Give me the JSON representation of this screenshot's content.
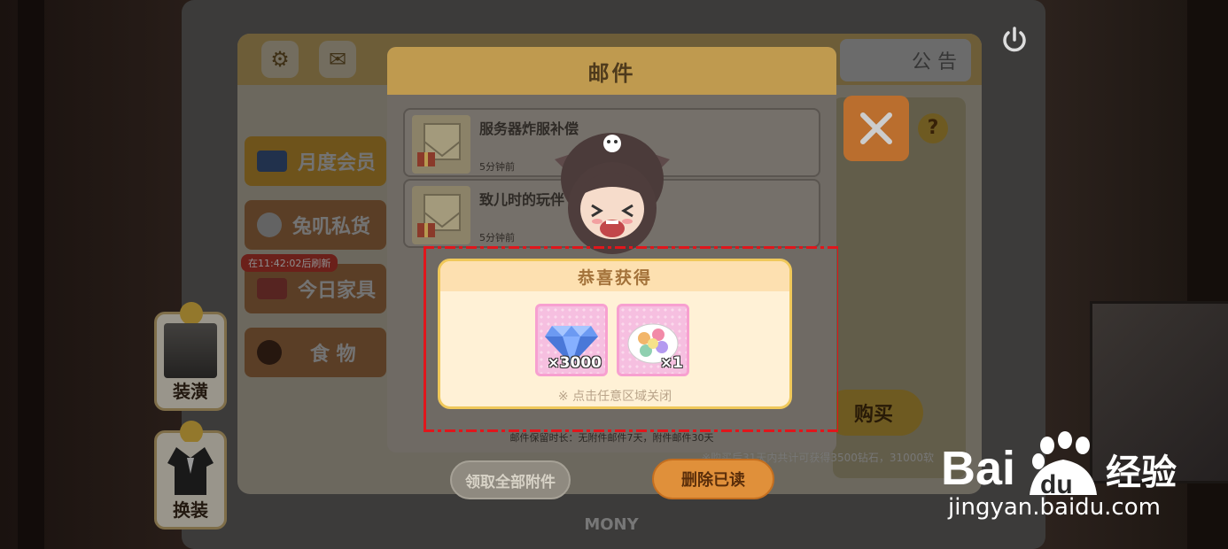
{
  "tv": {
    "brand_label": "MONY"
  },
  "shop": {
    "announce_tab": "公 告",
    "categories": [
      {
        "label": "月度会员"
      },
      {
        "label": "兔叽私货"
      },
      {
        "label": "今日家具",
        "timer": "在11:42:02后刷新"
      },
      {
        "label": "食 物"
      }
    ],
    "buy_label": "购买",
    "footer_note": "※购买后31天内共计可获得3500钻石，31000软"
  },
  "side_buttons": [
    {
      "label": "装潢"
    },
    {
      "label": "换装"
    }
  ],
  "mail": {
    "title": "邮件",
    "items": [
      {
        "title": "服务器炸服补偿",
        "time": "5分钟前"
      },
      {
        "title": "致儿时的玩伴",
        "time": "5分钟前"
      }
    ],
    "retention_note": "邮件保留时长：无附件邮件7天，附件邮件30天",
    "collect_all_label": "领取全部附件",
    "delete_read_label": "删除已读"
  },
  "reward": {
    "title": "恭喜获得",
    "items": [
      {
        "name": "diamond-icon",
        "qty": "×3000"
      },
      {
        "name": "macaron-plate-icon",
        "qty": "×1"
      }
    ],
    "hint": "※ 点击任意区域关闭"
  },
  "watermark": {
    "text": "jingyan.baidu.com",
    "brand": "Bai du 经验"
  },
  "colors": {
    "highlight": "#e0161c",
    "header": "#bf9a4f",
    "delete_btn": "#e0903a",
    "reward_border": "#f0c85a"
  }
}
